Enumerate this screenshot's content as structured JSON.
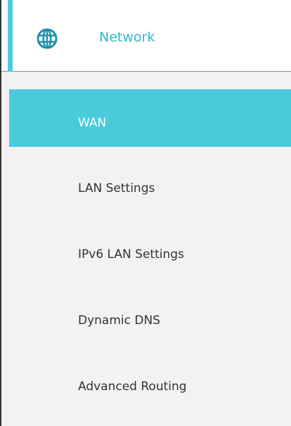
{
  "section": {
    "title": "Network",
    "icon": "globe-icon",
    "accent_color": "#4acbdc",
    "title_color": "#2db7d2"
  },
  "menu": {
    "active_item": "WAN",
    "items": [
      {
        "label": "WAN",
        "active": true
      },
      {
        "label": "LAN Settings",
        "active": false
      },
      {
        "label": "IPv6 LAN Settings",
        "active": false
      },
      {
        "label": "Dynamic DNS",
        "active": false
      },
      {
        "label": "Advanced Routing",
        "active": false
      }
    ]
  }
}
